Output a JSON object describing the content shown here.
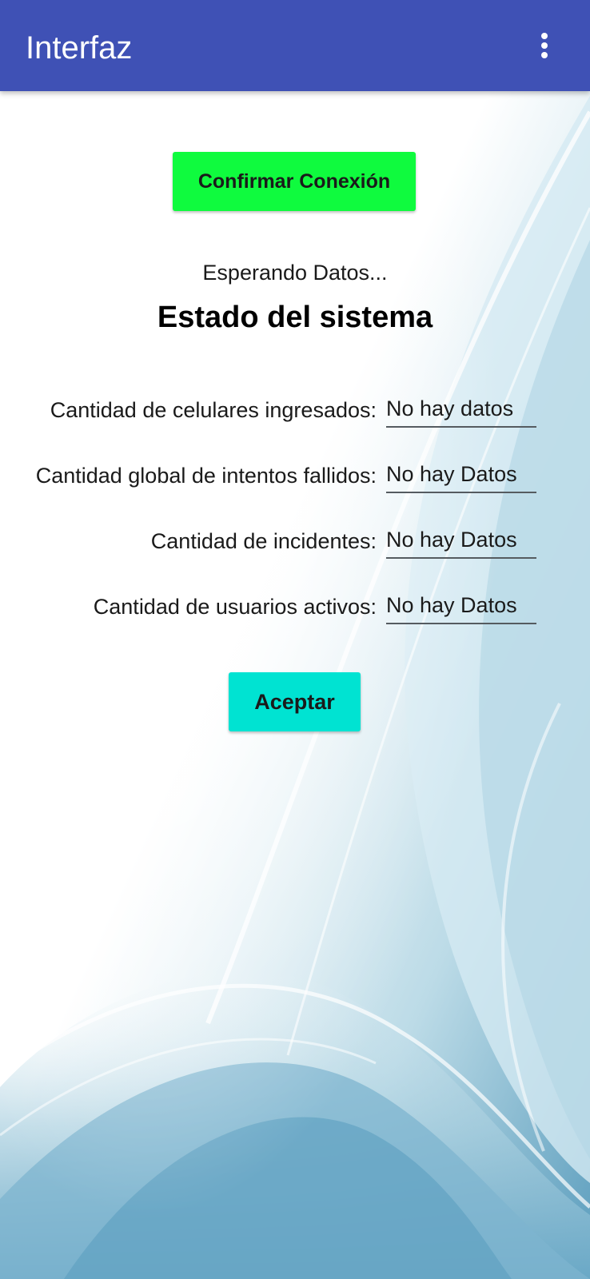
{
  "appbar": {
    "title": "Interfaz",
    "menu_icon": "more-vert-icon",
    "color": "#3f51b5"
  },
  "main": {
    "confirm_button": {
      "label": "Confirmar Conexión",
      "color": "#0ffb3e"
    },
    "status_text": "Esperando Datos...",
    "title": "Estado del sistema",
    "rows": [
      {
        "label": "Cantidad de celulares ingresados:",
        "value": "No hay datos"
      },
      {
        "label": "Cantidad global de intentos fallidos:",
        "value": "No hay Datos"
      },
      {
        "label": "Cantidad de incidentes:",
        "value": "No hay Datos"
      },
      {
        "label": "Cantidad de usuarios activos:",
        "value": "No hay Datos"
      }
    ],
    "accept_button": {
      "label": "Aceptar",
      "color": "#00e3d2"
    }
  },
  "background": {
    "style": "light-blue-abstract-waves",
    "colors": [
      "#ffffff",
      "#cfe6ee",
      "#6eaac6"
    ]
  }
}
